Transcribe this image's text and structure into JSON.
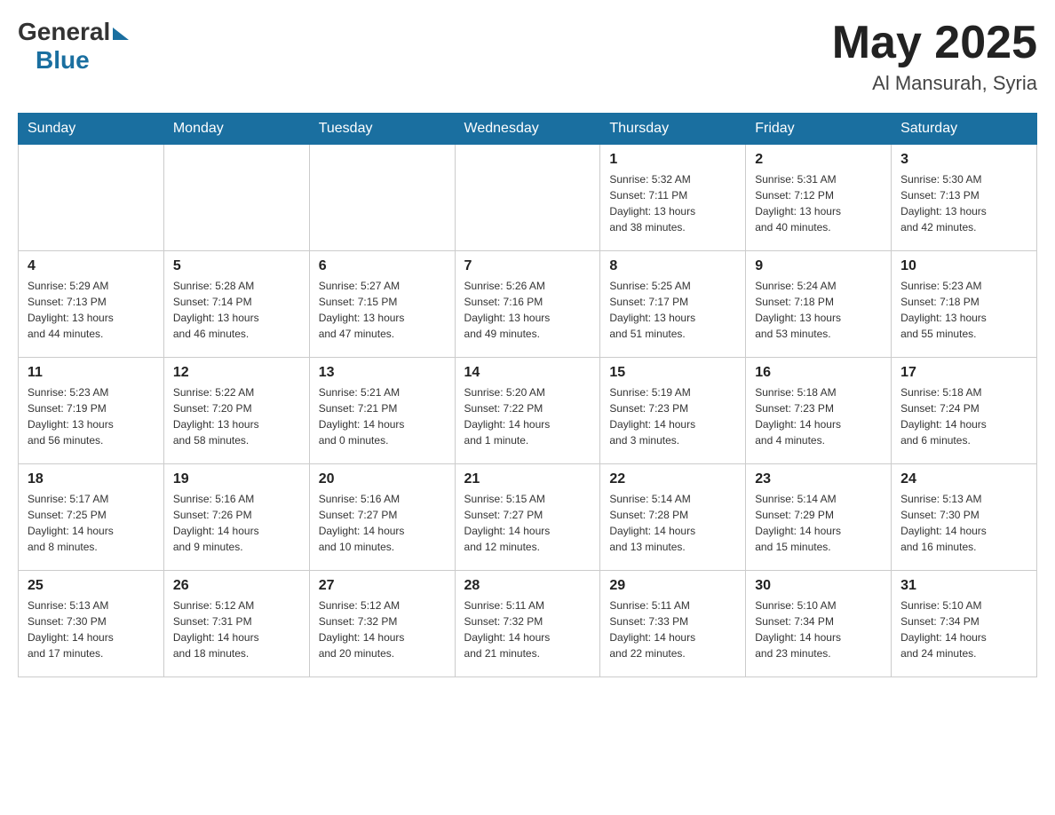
{
  "header": {
    "logo_general": "General",
    "logo_blue": "Blue",
    "month_year": "May 2025",
    "location": "Al Mansurah, Syria"
  },
  "days_of_week": [
    "Sunday",
    "Monday",
    "Tuesday",
    "Wednesday",
    "Thursday",
    "Friday",
    "Saturday"
  ],
  "weeks": [
    [
      {
        "day": "",
        "info": ""
      },
      {
        "day": "",
        "info": ""
      },
      {
        "day": "",
        "info": ""
      },
      {
        "day": "",
        "info": ""
      },
      {
        "day": "1",
        "info": "Sunrise: 5:32 AM\nSunset: 7:11 PM\nDaylight: 13 hours\nand 38 minutes."
      },
      {
        "day": "2",
        "info": "Sunrise: 5:31 AM\nSunset: 7:12 PM\nDaylight: 13 hours\nand 40 minutes."
      },
      {
        "day": "3",
        "info": "Sunrise: 5:30 AM\nSunset: 7:13 PM\nDaylight: 13 hours\nand 42 minutes."
      }
    ],
    [
      {
        "day": "4",
        "info": "Sunrise: 5:29 AM\nSunset: 7:13 PM\nDaylight: 13 hours\nand 44 minutes."
      },
      {
        "day": "5",
        "info": "Sunrise: 5:28 AM\nSunset: 7:14 PM\nDaylight: 13 hours\nand 46 minutes."
      },
      {
        "day": "6",
        "info": "Sunrise: 5:27 AM\nSunset: 7:15 PM\nDaylight: 13 hours\nand 47 minutes."
      },
      {
        "day": "7",
        "info": "Sunrise: 5:26 AM\nSunset: 7:16 PM\nDaylight: 13 hours\nand 49 minutes."
      },
      {
        "day": "8",
        "info": "Sunrise: 5:25 AM\nSunset: 7:17 PM\nDaylight: 13 hours\nand 51 minutes."
      },
      {
        "day": "9",
        "info": "Sunrise: 5:24 AM\nSunset: 7:18 PM\nDaylight: 13 hours\nand 53 minutes."
      },
      {
        "day": "10",
        "info": "Sunrise: 5:23 AM\nSunset: 7:18 PM\nDaylight: 13 hours\nand 55 minutes."
      }
    ],
    [
      {
        "day": "11",
        "info": "Sunrise: 5:23 AM\nSunset: 7:19 PM\nDaylight: 13 hours\nand 56 minutes."
      },
      {
        "day": "12",
        "info": "Sunrise: 5:22 AM\nSunset: 7:20 PM\nDaylight: 13 hours\nand 58 minutes."
      },
      {
        "day": "13",
        "info": "Sunrise: 5:21 AM\nSunset: 7:21 PM\nDaylight: 14 hours\nand 0 minutes."
      },
      {
        "day": "14",
        "info": "Sunrise: 5:20 AM\nSunset: 7:22 PM\nDaylight: 14 hours\nand 1 minute."
      },
      {
        "day": "15",
        "info": "Sunrise: 5:19 AM\nSunset: 7:23 PM\nDaylight: 14 hours\nand 3 minutes."
      },
      {
        "day": "16",
        "info": "Sunrise: 5:18 AM\nSunset: 7:23 PM\nDaylight: 14 hours\nand 4 minutes."
      },
      {
        "day": "17",
        "info": "Sunrise: 5:18 AM\nSunset: 7:24 PM\nDaylight: 14 hours\nand 6 minutes."
      }
    ],
    [
      {
        "day": "18",
        "info": "Sunrise: 5:17 AM\nSunset: 7:25 PM\nDaylight: 14 hours\nand 8 minutes."
      },
      {
        "day": "19",
        "info": "Sunrise: 5:16 AM\nSunset: 7:26 PM\nDaylight: 14 hours\nand 9 minutes."
      },
      {
        "day": "20",
        "info": "Sunrise: 5:16 AM\nSunset: 7:27 PM\nDaylight: 14 hours\nand 10 minutes."
      },
      {
        "day": "21",
        "info": "Sunrise: 5:15 AM\nSunset: 7:27 PM\nDaylight: 14 hours\nand 12 minutes."
      },
      {
        "day": "22",
        "info": "Sunrise: 5:14 AM\nSunset: 7:28 PM\nDaylight: 14 hours\nand 13 minutes."
      },
      {
        "day": "23",
        "info": "Sunrise: 5:14 AM\nSunset: 7:29 PM\nDaylight: 14 hours\nand 15 minutes."
      },
      {
        "day": "24",
        "info": "Sunrise: 5:13 AM\nSunset: 7:30 PM\nDaylight: 14 hours\nand 16 minutes."
      }
    ],
    [
      {
        "day": "25",
        "info": "Sunrise: 5:13 AM\nSunset: 7:30 PM\nDaylight: 14 hours\nand 17 minutes."
      },
      {
        "day": "26",
        "info": "Sunrise: 5:12 AM\nSunset: 7:31 PM\nDaylight: 14 hours\nand 18 minutes."
      },
      {
        "day": "27",
        "info": "Sunrise: 5:12 AM\nSunset: 7:32 PM\nDaylight: 14 hours\nand 20 minutes."
      },
      {
        "day": "28",
        "info": "Sunrise: 5:11 AM\nSunset: 7:32 PM\nDaylight: 14 hours\nand 21 minutes."
      },
      {
        "day": "29",
        "info": "Sunrise: 5:11 AM\nSunset: 7:33 PM\nDaylight: 14 hours\nand 22 minutes."
      },
      {
        "day": "30",
        "info": "Sunrise: 5:10 AM\nSunset: 7:34 PM\nDaylight: 14 hours\nand 23 minutes."
      },
      {
        "day": "31",
        "info": "Sunrise: 5:10 AM\nSunset: 7:34 PM\nDaylight: 14 hours\nand 24 minutes."
      }
    ]
  ]
}
